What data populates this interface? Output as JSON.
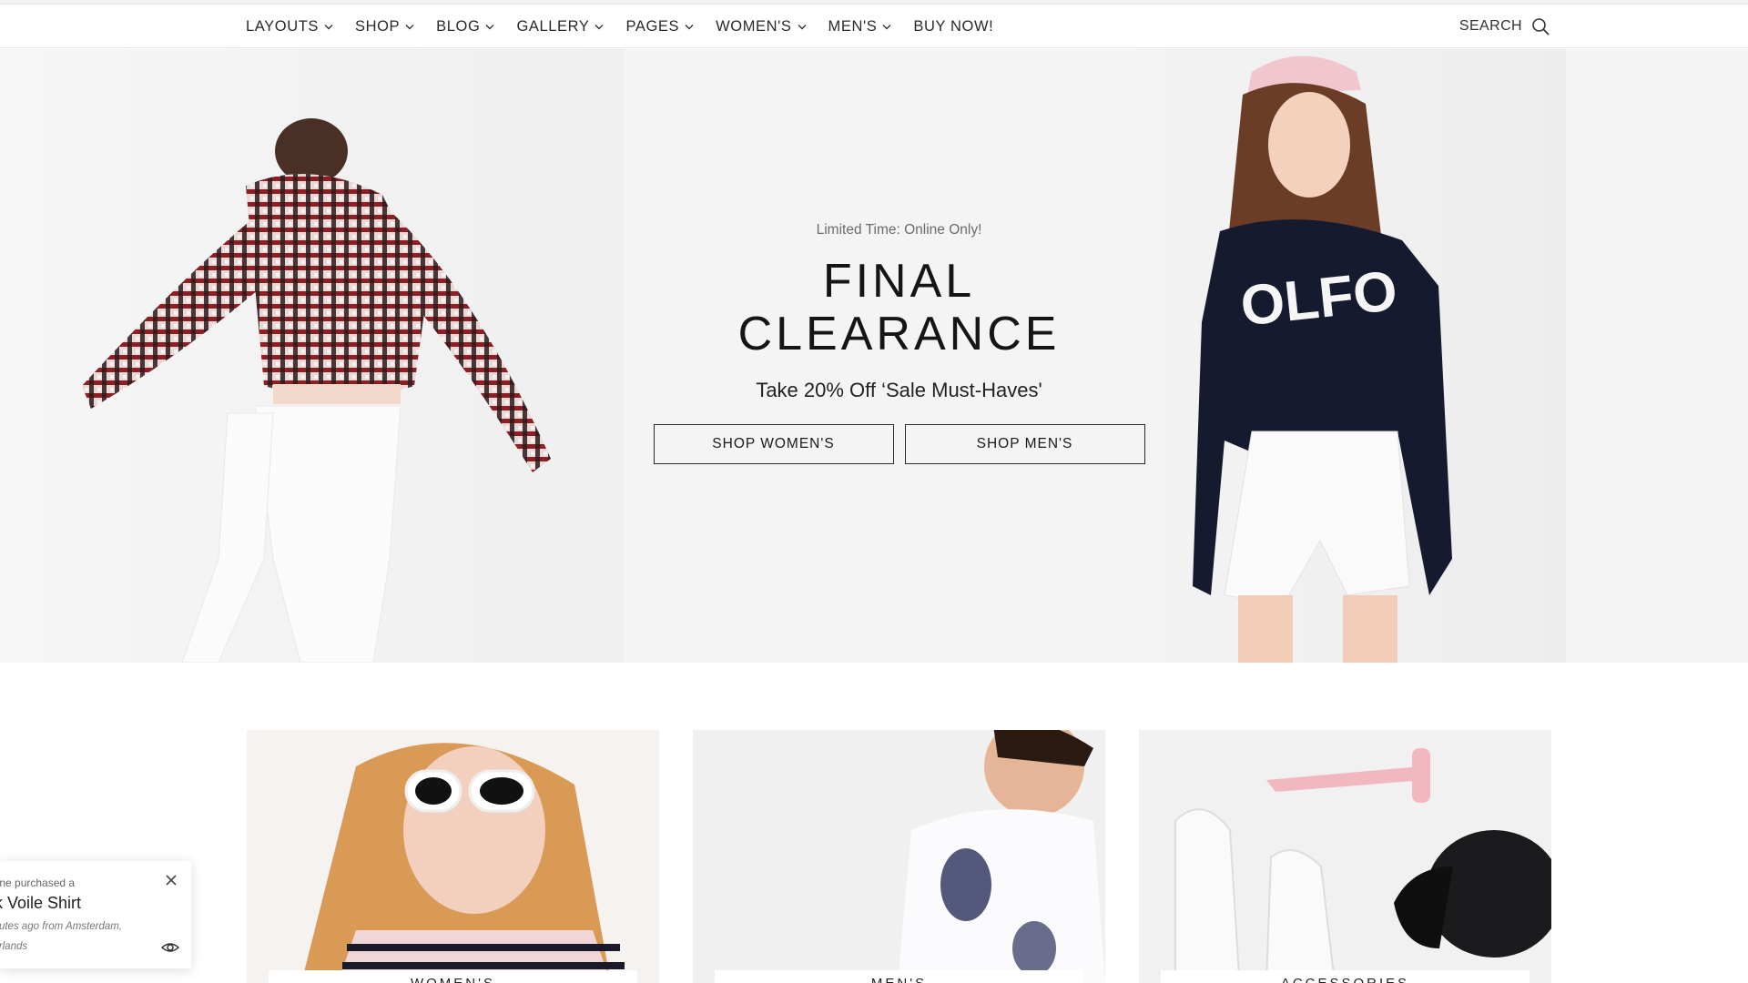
{
  "nav": {
    "items": [
      {
        "label": "LAYOUTS",
        "has_dropdown": true
      },
      {
        "label": "SHOP",
        "has_dropdown": true
      },
      {
        "label": "BLOG",
        "has_dropdown": true
      },
      {
        "label": "GALLERY",
        "has_dropdown": true
      },
      {
        "label": "PAGES",
        "has_dropdown": true
      },
      {
        "label": "WOMEN'S",
        "has_dropdown": true
      },
      {
        "label": "MEN'S",
        "has_dropdown": true
      },
      {
        "label": "BUY NOW!",
        "has_dropdown": false
      }
    ],
    "search_label": "SEARCH",
    "search_icon": "search-icon"
  },
  "hero": {
    "eyebrow": "Limited Time: Online Only!",
    "headline_line1": "FINAL",
    "headline_line2": "CLEARANCE",
    "subline": "Take 20% Off ‘Sale Must-Haves'",
    "cta_women": "SHOP WOMEN'S",
    "cta_men": "SHOP MEN'S"
  },
  "categories": [
    {
      "label": "WOMEN'S"
    },
    {
      "label": "MEN'S"
    },
    {
      "label": "ACCESSORIES"
    }
  ],
  "purchase_popup": {
    "line_small": "eone purchased a",
    "product": "k Voile Shirt",
    "meta_line1": "inutes ago from Amsterdam,",
    "meta_line2": "herlands",
    "close_icon": "close-icon",
    "view_icon": "eye-icon"
  },
  "colors": {
    "text": "#1a1a1a",
    "hero_bg": "#f4f4f5",
    "border": "#2a2a2a"
  }
}
